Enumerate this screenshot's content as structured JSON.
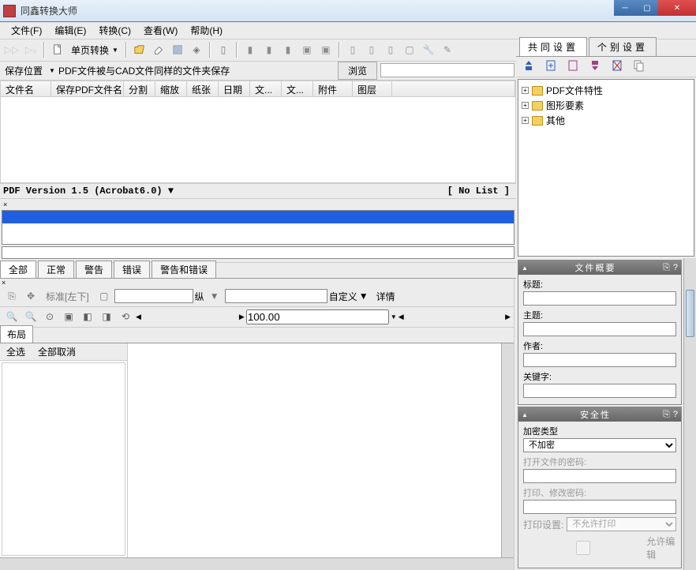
{
  "app": {
    "title": "同鑫转换大师"
  },
  "menu": {
    "file": "文件(F)",
    "edit": "编辑(E)",
    "convert": "转换(C)",
    "view": "查看(W)",
    "help": "帮助(H)"
  },
  "toolbar1": {
    "singlePage": "单页转换"
  },
  "savebar": {
    "label": "保存位置",
    "path": "PDF文件被与CAD文件同样的文件夹保存",
    "browse": "浏览"
  },
  "filegrid": {
    "cols": [
      "文件名",
      "保存PDF文件名",
      "分割",
      "缩放",
      "纸张",
      "日期",
      "文...",
      "文...",
      "附件",
      "图层"
    ]
  },
  "pdfver": {
    "text": "PDF Version 1.5 (Acrobat6.0)",
    "nolist": "[ No List ]"
  },
  "logtabs": {
    "all": "全部",
    "normal": "正常",
    "warn": "警告",
    "error": "错误",
    "warnerr": "警告和错误"
  },
  "viewtb": {
    "std": "标准[左下]",
    "v": "纵",
    "custom": "自定义",
    "detail": "详情",
    "zoom": "100.00"
  },
  "layout": {
    "tab": "布局",
    "selAll": "全选",
    "deselAll": "全部取消"
  },
  "rpanel": {
    "tabCommon": "共同设置",
    "tabIndiv": "个别设置",
    "tree": [
      "PDF文件特性",
      "图形要素",
      "其他"
    ]
  },
  "fileSummary": {
    "header": "文件概要",
    "title": "标题:",
    "subject": "主题:",
    "author": "作者:",
    "keywords": "关键字:"
  },
  "security": {
    "header": "安全性",
    "encType": "加密类型",
    "encValue": "不加密",
    "openPwd": "打开文件的密码:",
    "printPwd": "打印、修改密码:",
    "printSet": "打印设置:",
    "printVal": "不允许打印",
    "allowEdit": "允许编辑"
  }
}
